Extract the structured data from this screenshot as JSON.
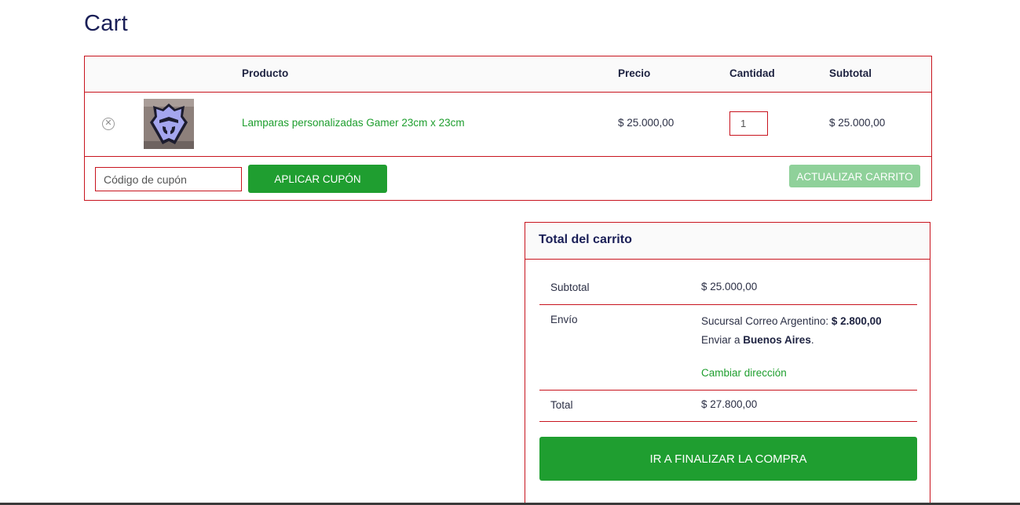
{
  "page": {
    "title": "Cart"
  },
  "cart": {
    "headers": {
      "product": "Producto",
      "price": "Precio",
      "quantity": "Cantidad",
      "subtotal": "Subtotal"
    },
    "items": [
      {
        "remove_icon": "close-circle-icon",
        "name": "Lamparas personalizadas Gamer 23cm x 23cm",
        "price": "$ 25.000,00",
        "quantity": "1",
        "subtotal": "$ 25.000,00"
      }
    ],
    "coupon_placeholder": "Código de cupón",
    "apply_coupon_label": "APLICAR CUPÓN",
    "update_cart_label": "ACTUALIZAR CARRITO"
  },
  "totals": {
    "title": "Total del carrito",
    "subtotal_label": "Subtotal",
    "subtotal_value": "$ 25.000,00",
    "shipping_label": "Envío",
    "shipping_method": "Sucursal Correo Argentino:",
    "shipping_cost": "$ 2.800,00",
    "ship_to_prefix": "Enviar a",
    "ship_to_place": "Buenos Aires",
    "ship_to_suffix": ".",
    "change_address_label": "Cambiar dirección",
    "total_label": "Total",
    "total_value": "$ 27.800,00",
    "checkout_label": "IR A FINALIZAR LA COMPRA"
  },
  "colors": {
    "accent_green": "#1f9e30",
    "disabled_green": "#8fd19a",
    "border_red": "#c8141e",
    "title_navy": "#1a1f57"
  }
}
